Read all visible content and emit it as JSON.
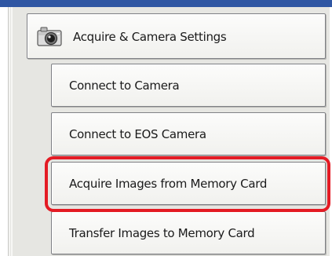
{
  "menu": {
    "header": {
      "label": "Acquire & Camera Settings",
      "icon": "camera-icon"
    },
    "items": [
      {
        "label": "Connect to Camera"
      },
      {
        "label": "Connect to EOS Camera"
      },
      {
        "label": "Acquire Images from Memory Card",
        "highlighted": true
      },
      {
        "label": "Transfer Images to Memory Card"
      }
    ]
  },
  "colors": {
    "accent_strip": "#2f56a3",
    "highlight": "#e41b24",
    "panel": "#e6e6e2"
  }
}
